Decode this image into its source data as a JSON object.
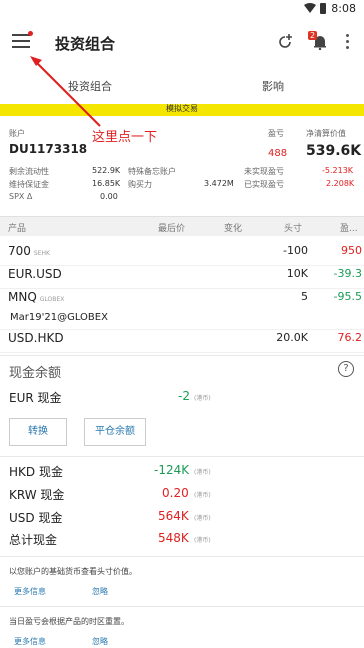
{
  "status_bar": {
    "time": "8:08"
  },
  "app_bar": {
    "title": "投资组合",
    "bell_badge": "2"
  },
  "tabs": [
    {
      "label": "投资组合"
    },
    {
      "label": "影响"
    }
  ],
  "banner": {
    "label": "模拟交易"
  },
  "annotation": {
    "text": "这里点一下"
  },
  "account": {
    "label": "账户",
    "id": "DU1173318",
    "pnl_label": "盈亏",
    "pnl_value": "488",
    "nlv_label": "净清算价值",
    "nlv_value": "539.6K",
    "metrics_left": [
      {
        "label": "剩余流动性",
        "value": "522.9K"
      },
      {
        "label": "维持保证金",
        "value": "16.85K"
      },
      {
        "label": "SPX Δ",
        "value": "0.00"
      }
    ],
    "metrics_mid": [
      {
        "label": "特殊备忘账户",
        "value": ""
      },
      {
        "label": "购买力",
        "value": "3.472M"
      }
    ],
    "metrics_right": [
      {
        "label": "未实现盈亏",
        "value": "-5.213K"
      },
      {
        "label": "已实现盈亏",
        "value": "2.208K"
      }
    ]
  },
  "positions_header": {
    "product": "产品",
    "last": "最后价",
    "change": "变化",
    "position": "头寸",
    "daily_pnl": "盈..."
  },
  "positions": [
    {
      "symbol": "700",
      "exch": "SEHK",
      "position": "-100",
      "pnl": "950",
      "color": "red"
    },
    {
      "symbol": "EUR.USD",
      "exch": "",
      "position": "10K",
      "pnl": "-39.3",
      "color": "green"
    },
    {
      "symbol": "MNQ",
      "exch": "GLOBEX",
      "position": "5",
      "pnl": "-95.5",
      "color": "green"
    },
    {
      "symbol": "Mar19'21@GLOBEX",
      "exch": "",
      "position": "",
      "pnl": "",
      "color": ""
    },
    {
      "symbol": "USD.HKD",
      "exch": "",
      "position": "20.0K",
      "pnl": "76.2",
      "color": "red"
    }
  ],
  "cash": {
    "title": "现金余额",
    "eur": {
      "label": "EUR 现金",
      "value": "-2",
      "unit": "(港币)"
    },
    "convert_btn": "转换",
    "flatten_btn": "平仓余额",
    "rows": [
      {
        "label": "HKD 现金",
        "value": "-124K",
        "unit": "(港币)",
        "color": "green"
      },
      {
        "label": "KRW 现金",
        "value": "0.20",
        "unit": "(港币)",
        "color": "red"
      },
      {
        "label": "USD 现金",
        "value": "564K",
        "unit": "(港币)",
        "color": "red"
      },
      {
        "label": "总计现金",
        "value": "548K",
        "unit": "(港币)",
        "color": "red"
      }
    ]
  },
  "notes": [
    {
      "text": "以您账户的基础货币查看头寸价值。",
      "more": "更多信息",
      "ignore": "忽略"
    },
    {
      "text": "当日盈亏会根据产品的时区重置。",
      "more": "更多信息",
      "ignore": "忽略"
    }
  ],
  "colors": {
    "red": "#e02020",
    "green": "#1a9d55",
    "link": "#2a7ab0",
    "banner": "#f5e600"
  }
}
